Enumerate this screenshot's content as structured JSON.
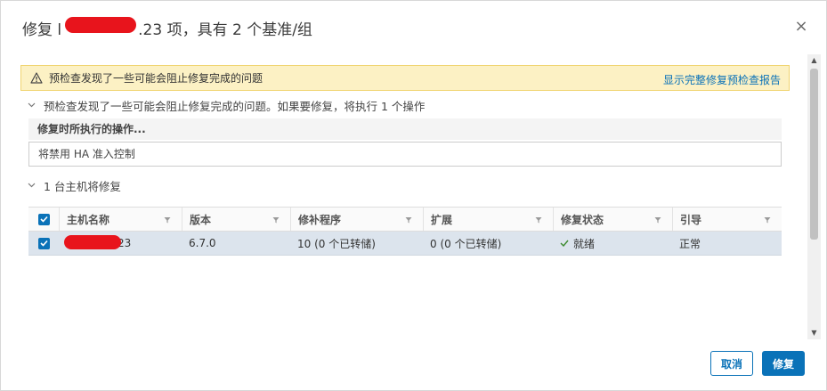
{
  "dialog": {
    "title_prefix": "修复 l",
    "title_suffix": ".23 项，具有 2 个基准/组",
    "close_glyph": "×"
  },
  "warning": {
    "text": "预检查发现了一些可能会阻止修复完成的问题",
    "link": "显示完整修复预检查报告"
  },
  "precheck_section": {
    "label": "预检查发现了一些可能会阻止修复完成的问题。如果要修复，将执行 1 个操作"
  },
  "operations": {
    "header": "修复时所执行的操作...",
    "items": [
      "将禁用 HA 准入控制"
    ]
  },
  "hosts_section": {
    "label": "1 台主机将修复"
  },
  "grid": {
    "columns": [
      "主机名称",
      "版本",
      "修补程序",
      "扩展",
      "修复状态",
      "引导"
    ],
    "rows": [
      {
        "host_suffix": "23",
        "version": "6.7.0",
        "patches": "10 (0 个已转储)",
        "extensions": "0 (0 个已转储)",
        "status": "就绪",
        "boot": "正常"
      }
    ]
  },
  "buttons": {
    "cancel": "取消",
    "remediate": "修复"
  },
  "colors": {
    "accent": "#0a72b8",
    "warning_bg": "#fcf1c4",
    "redaction": "#e8141c",
    "selected_row": "#dce4ed",
    "ok_green": "#3c8a2e"
  }
}
